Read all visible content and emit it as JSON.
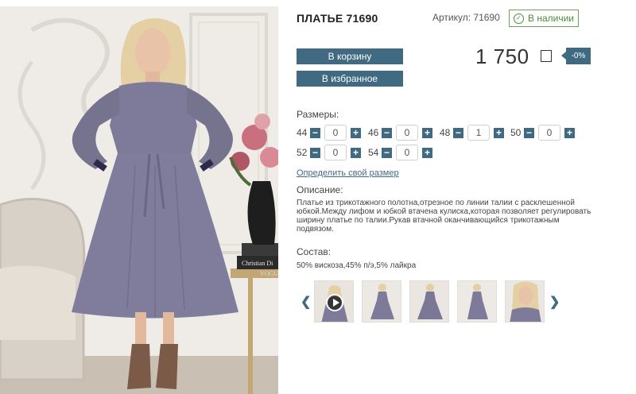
{
  "product": {
    "title": "ПЛАТЬЕ 71690",
    "sku": "Артикул: 71690",
    "stock": "В наличии",
    "price": "1 750",
    "discount": "-0%"
  },
  "actions": {
    "cart": "В корзину",
    "favorites": "В избранное"
  },
  "sizes": {
    "label": "Размеры:",
    "items": [
      {
        "size": "44",
        "qty": "0"
      },
      {
        "size": "46",
        "qty": "0"
      },
      {
        "size": "48",
        "qty": "1"
      },
      {
        "size": "50",
        "qty": "0"
      },
      {
        "size": "52",
        "qty": "0"
      },
      {
        "size": "54",
        "qty": "0"
      }
    ],
    "minus": "−",
    "plus": "+",
    "link": "Определить свой размер"
  },
  "description": {
    "label": "Описание:",
    "text": "Платье из трикотажного полотна,отрезное по линии талии с расклешенной юбкой.Между лифом и юбкой втачена кулиска,которая позволяет регулировать ширину платье по талии.Рукав втачной оканчивающийся трикотажным подвязом."
  },
  "composition": {
    "label": "Состав:",
    "text": "50% вискоза,45% п/э,5% лайкра"
  },
  "gallery": {
    "prev": "❮",
    "next": "❯",
    "thumbs": [
      "video-thumb",
      "full-front",
      "full-front-2",
      "full-side",
      "portrait"
    ]
  },
  "photo_text": {
    "book_top": "Christian Di",
    "book_bottom": "VOGU"
  },
  "colors": {
    "accent": "#3f6a82",
    "stock_green": "#4d8a3d",
    "dress": "#7d7a9a"
  }
}
